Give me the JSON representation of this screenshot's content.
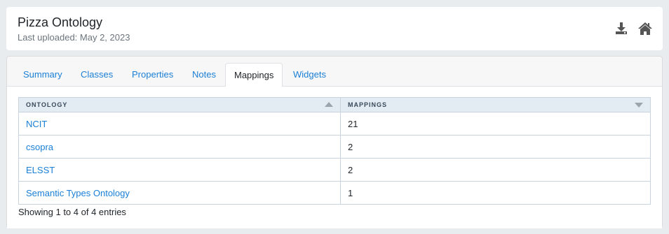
{
  "header": {
    "title": "Pizza Ontology",
    "subtitle": "Last uploaded: May 2, 2023",
    "icons": [
      "download-icon",
      "home-icon"
    ]
  },
  "tabs": [
    {
      "label": "Summary",
      "active": false
    },
    {
      "label": "Classes",
      "active": false
    },
    {
      "label": "Properties",
      "active": false
    },
    {
      "label": "Notes",
      "active": false
    },
    {
      "label": "Mappings",
      "active": true
    },
    {
      "label": "Widgets",
      "active": false
    }
  ],
  "table": {
    "columns": [
      "ONTOLOGY",
      "MAPPINGS"
    ],
    "rows": [
      {
        "ontology": "NCIT",
        "mappings": "21"
      },
      {
        "ontology": "csopra",
        "mappings": "2"
      },
      {
        "ontology": "ELSST",
        "mappings": "2"
      },
      {
        "ontology": "Semantic Types Ontology",
        "mappings": "1"
      }
    ],
    "info": "Showing 1 to 4 of 4 entries"
  },
  "colors": {
    "link": "#1a7fd6",
    "header_bg": "#e3ebf3",
    "page_bg": "#e9ecef"
  }
}
